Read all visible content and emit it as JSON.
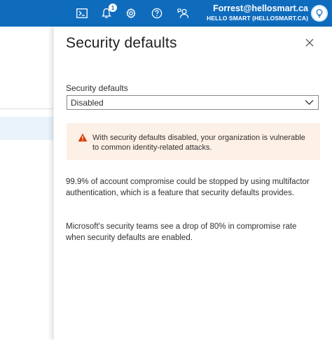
{
  "topbar": {
    "icons": [
      "cloud-shell-icon",
      "notifications-icon",
      "settings-icon",
      "help-icon",
      "feedback-icon"
    ],
    "notification_count": "1",
    "account_email": "Forrest@hellosmart.ca",
    "account_tenant": "HELLO SMART (HELLOSMART.CA)",
    "color": "#0f6cbd"
  },
  "panel": {
    "title": "Security defaults",
    "field_label": "Security defaults",
    "select_value": "Disabled",
    "warning_text": "With security defaults disabled, your organization is vulnerable to common identity-related attacks.",
    "paragraph1": "99.9% of account compromise could be stopped by using multifactor authentication, which is a feature that security defaults provides.",
    "paragraph2": "Microsoft's security teams see a drop of 80% in compromise rate when security defaults are enabled.",
    "warning_icon_color": "#d83b01"
  }
}
